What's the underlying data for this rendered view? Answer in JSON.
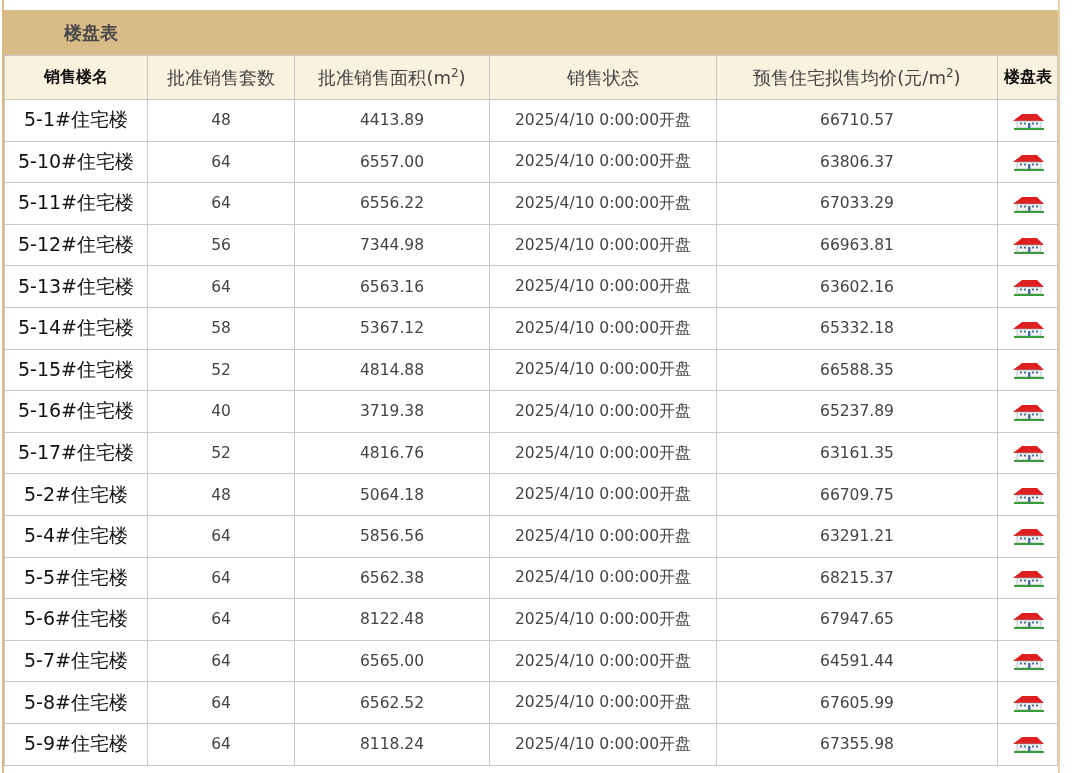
{
  "title": "楼盘表",
  "columns": [
    "销售楼名",
    "批准销售套数",
    "批准销售面积(m$^{2}$)",
    "销售状态",
    "预售住宅拟售均价(元/m$^{2}$)",
    "楼盘表"
  ],
  "rows": [
    {
      "building": "5-1#住宅楼",
      "units": "48",
      "area": "4413.89",
      "status": "2025/4/10 0:00:00开盘",
      "avg_price": "66710.57"
    },
    {
      "building": "5-10#住宅楼",
      "units": "64",
      "area": "6557.00",
      "status": "2025/4/10 0:00:00开盘",
      "avg_price": "63806.37"
    },
    {
      "building": "5-11#住宅楼",
      "units": "64",
      "area": "6556.22",
      "status": "2025/4/10 0:00:00开盘",
      "avg_price": "67033.29"
    },
    {
      "building": "5-12#住宅楼",
      "units": "56",
      "area": "7344.98",
      "status": "2025/4/10 0:00:00开盘",
      "avg_price": "66963.81"
    },
    {
      "building": "5-13#住宅楼",
      "units": "64",
      "area": "6563.16",
      "status": "2025/4/10 0:00:00开盘",
      "avg_price": "63602.16"
    },
    {
      "building": "5-14#住宅楼",
      "units": "58",
      "area": "5367.12",
      "status": "2025/4/10 0:00:00开盘",
      "avg_price": "65332.18"
    },
    {
      "building": "5-15#住宅楼",
      "units": "52",
      "area": "4814.88",
      "status": "2025/4/10 0:00:00开盘",
      "avg_price": "66588.35"
    },
    {
      "building": "5-16#住宅楼",
      "units": "40",
      "area": "3719.38",
      "status": "2025/4/10 0:00:00开盘",
      "avg_price": "65237.89"
    },
    {
      "building": "5-17#住宅楼",
      "units": "52",
      "area": "4816.76",
      "status": "2025/4/10 0:00:00开盘",
      "avg_price": "63161.35"
    },
    {
      "building": "5-2#住宅楼",
      "units": "48",
      "area": "5064.18",
      "status": "2025/4/10 0:00:00开盘",
      "avg_price": "66709.75"
    },
    {
      "building": "5-4#住宅楼",
      "units": "64",
      "area": "5856.56",
      "status": "2025/4/10 0:00:00开盘",
      "avg_price": "63291.21"
    },
    {
      "building": "5-5#住宅楼",
      "units": "64",
      "area": "6562.38",
      "status": "2025/4/10 0:00:00开盘",
      "avg_price": "68215.37"
    },
    {
      "building": "5-6#住宅楼",
      "units": "64",
      "area": "8122.48",
      "status": "2025/4/10 0:00:00开盘",
      "avg_price": "67947.65"
    },
    {
      "building": "5-7#住宅楼",
      "units": "64",
      "area": "6565.00",
      "status": "2025/4/10 0:00:00开盘",
      "avg_price": "64591.44"
    },
    {
      "building": "5-8#住宅楼",
      "units": "64",
      "area": "6562.52",
      "status": "2025/4/10 0:00:00开盘",
      "avg_price": "67605.99"
    },
    {
      "building": "5-9#住宅楼",
      "units": "64",
      "area": "8118.24",
      "status": "2025/4/10 0:00:00开盘",
      "avg_price": "67355.98"
    }
  ]
}
